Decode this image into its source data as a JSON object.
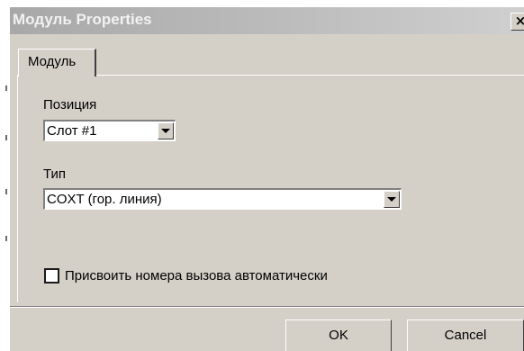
{
  "window": {
    "title": "Модуль Properties",
    "close_glyph": "×",
    "close_icon": "close-icon"
  },
  "tabs": [
    {
      "label": "Модуль",
      "selected": true
    }
  ],
  "position": {
    "label": "Позиция",
    "value": "Слот #1"
  },
  "type": {
    "label": "Тип",
    "value": "COXT (гор. линия)"
  },
  "auto_numbers": {
    "label": "Присвоить номера вызова автоматически",
    "checked": false
  },
  "buttons": {
    "ok": "OK",
    "cancel": "Cancel"
  }
}
